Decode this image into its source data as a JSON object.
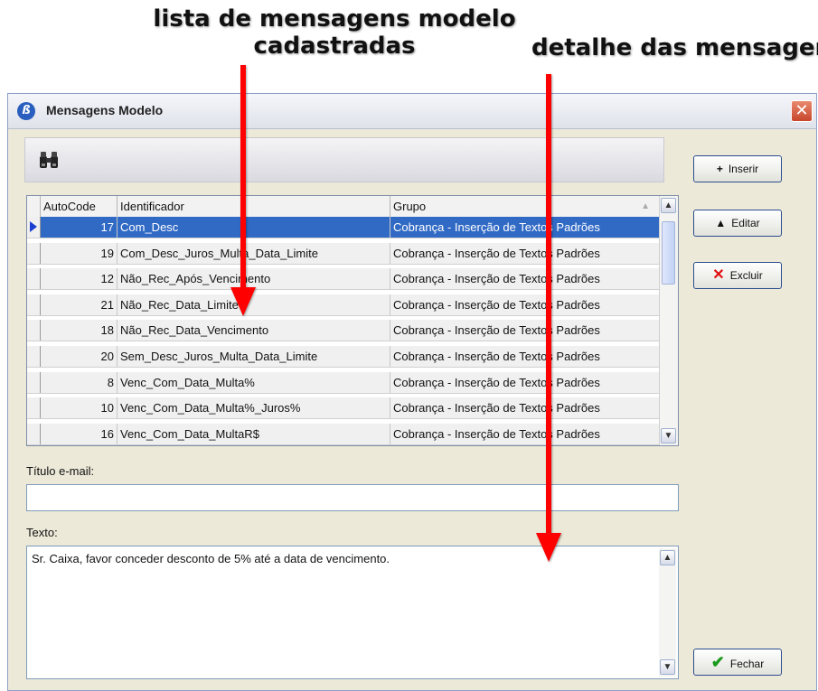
{
  "annotations": {
    "list_line1": "lista de mensagens modelo",
    "list_line2": "cadastradas",
    "detail": "detalhe das mensagens"
  },
  "window": {
    "title": "Mensagens Modelo",
    "app_icon": "ß",
    "close_glyph": "✕"
  },
  "grid": {
    "columns": [
      "AutoCode",
      "Identificador",
      "Grupo"
    ],
    "rows": [
      {
        "code": "17",
        "id": "Com_Desc",
        "grupo": "Cobrança - Inserção de Textos Padrões"
      },
      {
        "code": "19",
        "id": "Com_Desc_Juros_Multa_Data_Limite",
        "grupo": "Cobrança - Inserção de Textos Padrões"
      },
      {
        "code": "12",
        "id": "Não_Rec_Após_Vencimento",
        "grupo": "Cobrança - Inserção de Textos Padrões"
      },
      {
        "code": "21",
        "id": "Não_Rec_Data_Limite",
        "grupo": "Cobrança - Inserção de Textos Padrões"
      },
      {
        "code": "18",
        "id": "Não_Rec_Data_Vencimento",
        "grupo": "Cobrança - Inserção de Textos Padrões"
      },
      {
        "code": "20",
        "id": "Sem_Desc_Juros_Multa_Data_Limite",
        "grupo": "Cobrança - Inserção de Textos Padrões"
      },
      {
        "code": "8",
        "id": "Venc_Com_Data_Multa%",
        "grupo": "Cobrança - Inserção de Textos Padrões"
      },
      {
        "code": "10",
        "id": "Venc_Com_Data_Multa%_Juros%",
        "grupo": "Cobrança - Inserção de Textos Padrões"
      },
      {
        "code": "16",
        "id": "Venc_Com_Data_MultaR$",
        "grupo": "Cobrança - Inserção de Textos Padrões"
      }
    ]
  },
  "form": {
    "titulo_label": "Título e-mail:",
    "titulo_value": "",
    "texto_label": "Texto:",
    "texto_value": "Sr. Caixa, favor conceder desconto de 5% até a data de vencimento."
  },
  "buttons": {
    "inserir": "Inserir",
    "editar": "Editar",
    "excluir": "Excluir",
    "fechar": "Fechar"
  },
  "colors": {
    "selection": "#316ac5",
    "arrow": "#ff0000"
  }
}
